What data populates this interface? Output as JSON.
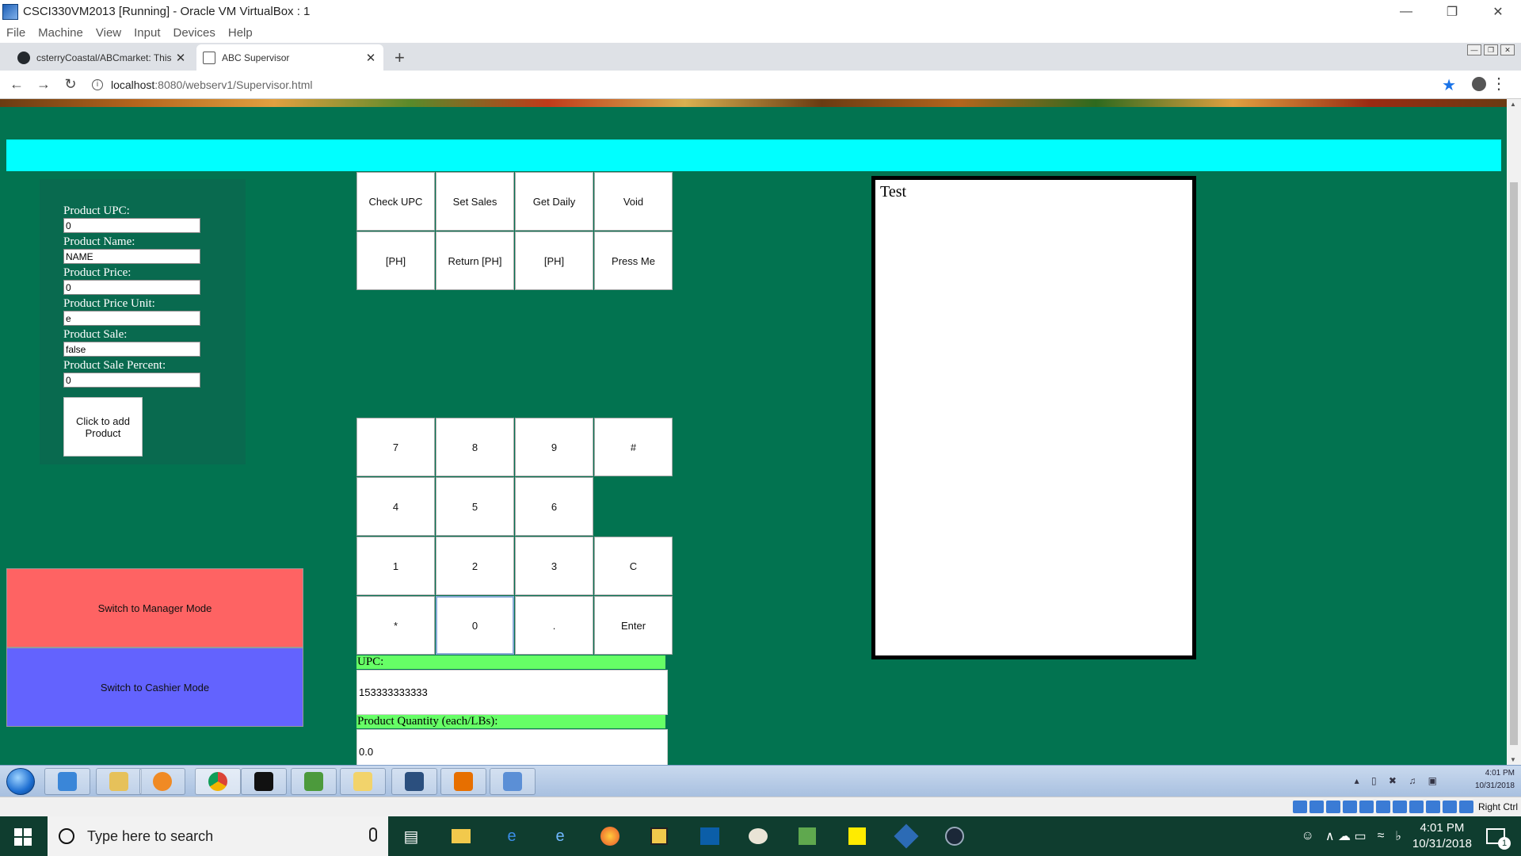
{
  "host_window": {
    "title": "CSCI330VM2013 [Running] - Oracle VM VirtualBox : 1",
    "menu": [
      "File",
      "Machine",
      "View",
      "Input",
      "Devices",
      "Help"
    ],
    "controls": {
      "minimize": "—",
      "restore": "❐",
      "close": "✕"
    }
  },
  "browser": {
    "tabs": [
      {
        "label": "csterryCoastal/ABCmarket: This p",
        "close": "✕"
      },
      {
        "label": "ABC Supervisor",
        "close": "✕"
      }
    ],
    "new_tab": "+",
    "nav": {
      "back": "←",
      "forward": "→",
      "reload": "↻"
    },
    "url": {
      "host": "localhost",
      "path": ":8080/webserv1/Supervisor.html"
    },
    "star": "★",
    "kebab": "⋮"
  },
  "product_form": {
    "upc_label": "Product UPC:",
    "upc_value": "0",
    "name_label": "Product Name:",
    "name_value": "NAME",
    "price_label": "Product Price:",
    "price_value": "0",
    "unit_label": "Product Price Unit:",
    "unit_value": "e",
    "sale_label": "Product Sale:",
    "sale_value": "false",
    "percent_label": "Product Sale Percent:",
    "percent_value": "0",
    "add_button": "Click to add Product"
  },
  "mode_buttons": {
    "manager": "Switch to Manager Mode",
    "cashier": "Switch to Cashier Mode"
  },
  "function_keys": {
    "check_upc": "Check UPC",
    "set_sales": "Set Sales",
    "get_daily": "Get Daily",
    "void": "Void",
    "ph1": "[PH]",
    "return_ph": "Return [PH]",
    "ph2": "[PH]",
    "press_me": "Press Me"
  },
  "keypad": {
    "k7": "7",
    "k8": "8",
    "k9": "9",
    "hash": "#",
    "k4": "4",
    "k5": "5",
    "k6": "6",
    "k1": "1",
    "k2": "2",
    "k3": "3",
    "clear": "C",
    "star": "*",
    "k0": "0",
    "dot": ".",
    "enter": "Enter"
  },
  "entry": {
    "upc_label": "UPC:",
    "upc_value": "153333333333",
    "qty_label": "Product Quantity (each/LBs):",
    "qty_value": "0.0"
  },
  "output_box": {
    "text": "Test"
  },
  "guest_taskbar": {
    "time": "4:01 PM",
    "date": "10/31/2018",
    "tray_glyphs": "▴ ▯ ✖ ♫ ▣"
  },
  "vb_status": {
    "host_key": "Right Ctrl"
  },
  "host_taskbar": {
    "search_placeholder": "Type here to search",
    "time": "4:01 PM",
    "date": "10/31/2018",
    "notifications": "1",
    "tray_glyphs": "∧ ☁ ▭"
  },
  "colors": {
    "page_bg": "#027350",
    "cyan_bar": "#00ffff",
    "manager_mode": "#fe6363",
    "cashier_mode": "#6363fe",
    "label_highlight": "#66ff66"
  }
}
